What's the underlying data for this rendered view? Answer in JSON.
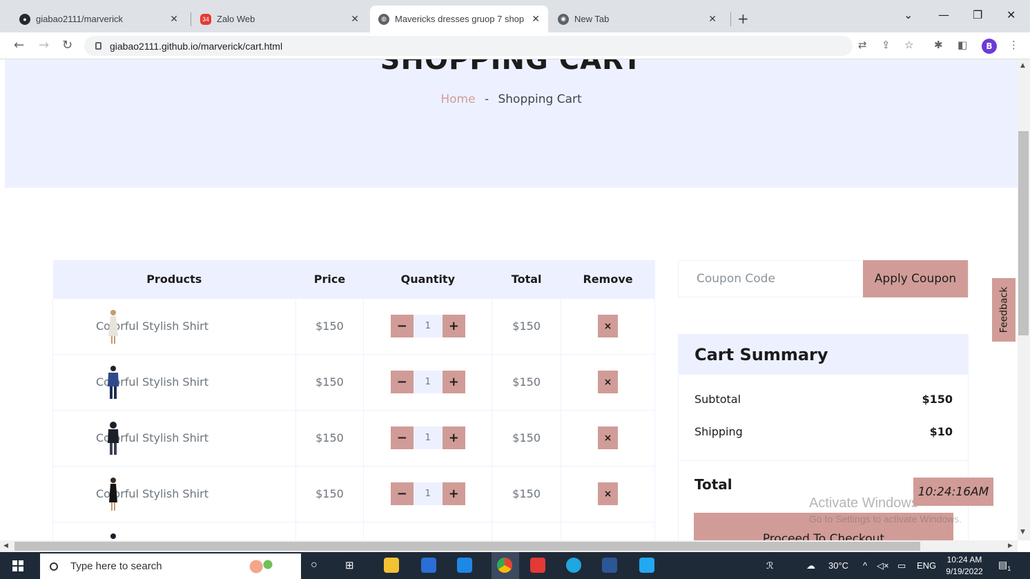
{
  "browser": {
    "tabs": [
      {
        "title": "giabao2111/marverick",
        "icon": "github-icon"
      },
      {
        "title": "Zalo Web",
        "icon": "zalo-icon",
        "badge": "34"
      },
      {
        "title": "Mavericks dresses gruop 7 shop",
        "icon": "globe-icon",
        "active": true
      },
      {
        "title": "New Tab",
        "icon": "chrome-icon"
      }
    ],
    "url": "giabao2111.github.io/marverick/cart.html",
    "profile_initial": "B"
  },
  "page": {
    "heading": "SHOPPING CART",
    "breadcrumb": {
      "home": "Home",
      "separator": "-",
      "current": "Shopping Cart"
    },
    "cart": {
      "columns": [
        "Products",
        "Price",
        "Quantity",
        "Total",
        "Remove"
      ],
      "rows": [
        {
          "name": "Colorful Stylish Shirt",
          "price": "$150",
          "qty": "1",
          "total": "$150"
        },
        {
          "name": "Colorful Stylish Shirt",
          "price": "$150",
          "qty": "1",
          "total": "$150"
        },
        {
          "name": "Colorful Stylish Shirt",
          "price": "$150",
          "qty": "1",
          "total": "$150"
        },
        {
          "name": "Colorful Stylish Shirt",
          "price": "$150",
          "qty": "1",
          "total": "$150"
        }
      ],
      "minus": "−",
      "plus": "+",
      "remove": "×"
    },
    "coupon": {
      "placeholder": "Coupon Code",
      "button": "Apply Coupon"
    },
    "summary": {
      "title": "Cart Summary",
      "subtotal_label": "Subtotal",
      "subtotal": "$150",
      "shipping_label": "Shipping",
      "shipping": "$10",
      "total_label": "Total",
      "checkout": "Proceed To Checkout"
    },
    "feedback": "Feedback",
    "clock": "10:24:16AM",
    "watermark": {
      "line1": "Activate Windows",
      "line2": "Go to Settings to activate Windows."
    }
  },
  "taskbar": {
    "search_placeholder": "Type here to search",
    "weather": "30°C",
    "language": "ENG",
    "time": "10:24 AM",
    "date": "9/19/2022",
    "notification_count": "1"
  },
  "colors": {
    "accent": "#d19c97",
    "light": "#edf1ff",
    "dark": "#1c1c1c"
  }
}
